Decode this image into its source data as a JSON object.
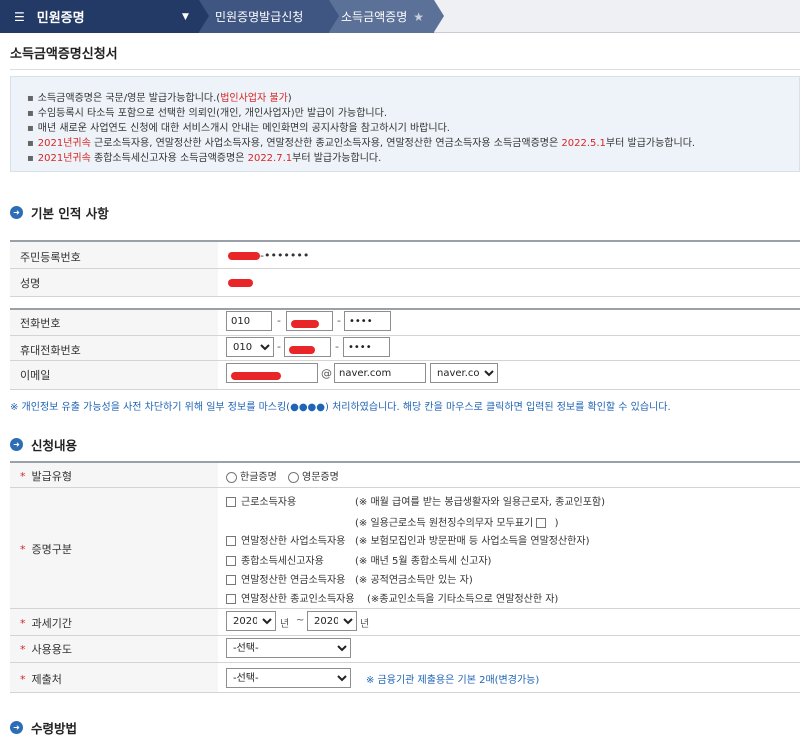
{
  "nav": {
    "menu_label": "민원증명",
    "crumbs": [
      "민원증명발급신청",
      "소득금액증명"
    ]
  },
  "page": {
    "title": "소득금액증명신청서"
  },
  "notice": {
    "lines": [
      {
        "parts": [
          "소득금액증명은 국문/영문 발급가능합니다.(",
          "법인사업자 불가",
          ")"
        ]
      },
      {
        "parts": [
          "수임등록시 타소득 포함으로 선택한 의뢰인(개인, 개인사업자)만 발급이 가능합니다."
        ]
      },
      {
        "parts": [
          "매년 새로운 사업연도 신청에 대한 서비스개시 안내는 메인화면의 공지사항을 참고하시기 바랍니다."
        ]
      },
      {
        "parts": [
          "2021년귀속",
          " 근로소득자용, 연말정산한 사업소득자용, 연말정산한 종교인소득자용, 연말정산한 연금소득자용 소득금액증명은 ",
          "2022.5.1",
          "부터 발급가능합니다."
        ]
      },
      {
        "parts": [
          "2021년귀속",
          " 종합소득세신고자용 소득금액증명은 ",
          "2022.7.1",
          "부터 발급가능합니다."
        ]
      }
    ]
  },
  "sections": {
    "basic": "기본 인적 사항",
    "request": "신청내용",
    "receive": "수령방법"
  },
  "basic": {
    "rrn_label": "주민등록번호",
    "rrn_suffix": "-•••••••",
    "name_label": "성명",
    "phone_label": "전화번호",
    "phone_prefix": "010",
    "phone_last": "••••",
    "mobile_label": "휴대전화번호",
    "mobile_prefix": "010",
    "mobile_last": "••••",
    "email_label": "이메일",
    "email_at": "@",
    "email_domain": "naver.com",
    "email_select": "naver.com"
  },
  "info_note": "※ 개인정보 유출 가능성을 사전 차단하기 위해 일부 정보를 마스킹(●●●●) 처리하였습니다. 해당 칸을 마우스로 클릭하면 입력된 정보를 확인할 수 있습니다.",
  "request": {
    "type_label": "발급유형",
    "type_korean": "한글증명",
    "type_english": "영문증명",
    "category_label": "증명구분",
    "opt1": "근로소득자용",
    "opt1_note": "(※ 매월 급여를 받는 봉급생활자와 일용근로자, 종교인포함)",
    "opt1_sub_open": "(※ 일용근로소득 원천징수의무자 모두표기",
    "opt1_sub_close": ")",
    "opt2": "연말정산한 사업소득자용",
    "opt2_note": "(※ 보험모집인과 방문판매 등 사업소득을 연말정산한자)",
    "opt3": "종합소득세신고자용",
    "opt3_note": "(※ 매년 5월 종합소득세 신고자)",
    "opt4": "연말정산한 연금소득자용",
    "opt4_note": "(※ 공적연금소득만 있는 자)",
    "opt5": "연말정산한 종교인소득자용",
    "opt5_note": "(※종교인소득을 기타소득으로 연말정산한 자)",
    "period_label": "과세기간",
    "year_from": "2020",
    "year_unit": "년",
    "tilde": "~",
    "year_to": "2020",
    "purpose_label": "사용용도",
    "purpose_value": "-선택-",
    "submit_label": "제출처",
    "submit_value": "-선택-",
    "submit_note": "※ 금융기관 제출용은 기본 2매(변경가능)"
  },
  "colors": {
    "nav_dark": "#243a66",
    "accent_red": "#d72626",
    "note_blue": "#1f64b5"
  }
}
